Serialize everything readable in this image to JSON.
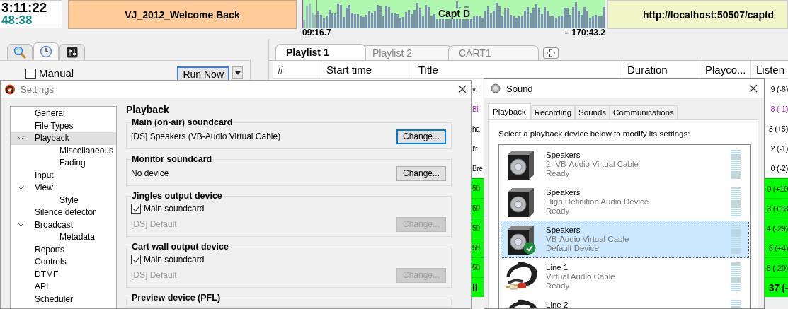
{
  "top_bar": {
    "clock": {
      "time": "3:11:22",
      "remaining": "48:38"
    },
    "now_playing": "VJ_2012_Welcome Back",
    "waveform": {
      "title": "Capt D",
      "elapsed": "09:16.7",
      "remaining": "– 170:43.2"
    },
    "stream_url": "http://localhost:50507/captd"
  },
  "left_panel": {
    "tabs": [
      {
        "kind": "search",
        "selected": false
      },
      {
        "kind": "clock",
        "selected": true
      },
      {
        "kind": "mixer",
        "selected": false
      }
    ],
    "manual": {
      "label": "Manual",
      "checked": false
    },
    "run_now": {
      "label": "Run Now",
      "focused": true
    }
  },
  "playlist": {
    "tabs": [
      {
        "label": "Playlist 1",
        "selected": true
      },
      {
        "label": "Playlist 2",
        "selected": false
      },
      {
        "label": "CART1",
        "selected": false
      }
    ],
    "columns": [
      "#",
      "Start time",
      "Title",
      "Duration",
      "Playco...",
      "Listen"
    ],
    "rows": [
      {
        "kind": "plain",
        "title": "yl",
        "listeners": "9 (-6)"
      },
      {
        "kind": "purple",
        "title": "Bi",
        "listeners": "8 (-1)"
      },
      {
        "kind": "plain",
        "title": "ha",
        "listeners": "3 (+5)"
      },
      {
        "kind": "plain",
        "title": "I'r",
        "listeners": "2 (-1)"
      },
      {
        "kind": "plain",
        "title": "Bre",
        "listeners": "0 (-2)"
      },
      {
        "kind": "green",
        "title": "50",
        "listeners": "0 (+10"
      },
      {
        "kind": "green",
        "title": "50",
        "listeners": "3 (+13"
      },
      {
        "kind": "green",
        "title": "50",
        "listeners": "4 (-29)"
      },
      {
        "kind": "green",
        "title": "50",
        "listeners": "8 (+4)"
      },
      {
        "kind": "green",
        "title": "50",
        "listeners": "8 (-20)"
      },
      {
        "kind": "green_bold",
        "title": "ll",
        "listeners": "37 (-"
      }
    ]
  },
  "settings_window": {
    "title": "Settings",
    "tree": [
      {
        "label": "General",
        "selected": false
      },
      {
        "label": "File Types",
        "selected": false
      },
      {
        "label": "Playback",
        "selected": true,
        "expanded": true,
        "children": [
          {
            "label": "Miscellaneous",
            "selected": false
          },
          {
            "label": "Fading",
            "selected": false
          }
        ]
      },
      {
        "label": "Input",
        "selected": false
      },
      {
        "label": "View",
        "selected": false,
        "expanded": true,
        "children": [
          {
            "label": "Style",
            "selected": false
          }
        ]
      },
      {
        "label": "Silence detector",
        "selected": false
      },
      {
        "label": "Broadcast",
        "selected": false,
        "expanded": true,
        "children": [
          {
            "label": "Metadata",
            "selected": false
          }
        ]
      },
      {
        "label": "Reports",
        "selected": false
      },
      {
        "label": "Controls",
        "selected": false
      },
      {
        "label": "DTMF",
        "selected": false
      },
      {
        "label": "API",
        "selected": false
      },
      {
        "label": "Scheduler",
        "selected": false
      }
    ],
    "heading": "Playback",
    "groups": [
      {
        "title": "Main (on-air) soundcard",
        "device": "[DS] Speakers (VB-Audio Virtual Cable)",
        "button": "Change...",
        "disabled": false,
        "focused": true
      },
      {
        "title": "Monitor soundcard",
        "device": "No device",
        "button": "Change...",
        "disabled": false,
        "focused": false
      },
      {
        "title": "Jingles output device",
        "option": {
          "label": "Main soundcard",
          "checked": true
        },
        "device": "[DS] Default",
        "button": "Change...",
        "disabled": true,
        "focused": false
      },
      {
        "title": "Cart wall output device",
        "option": {
          "label": "Main soundcard",
          "checked": true
        },
        "device": "[DS] Default",
        "button": "Change...",
        "disabled": true,
        "focused": false
      },
      {
        "title": "Preview device (PFL)"
      }
    ]
  },
  "sound_window": {
    "title": "Sound",
    "tabs": [
      {
        "label": "Playback",
        "selected": true
      },
      {
        "label": "Recording",
        "selected": false
      },
      {
        "label": "Sounds",
        "selected": false
      },
      {
        "label": "Communications",
        "selected": false
      }
    ],
    "instruction": "Select a playback device below to modify its settings:",
    "devices": [
      {
        "kind": "speaker",
        "name": "Speakers",
        "description": "2- VB-Audio Virtual Cable",
        "status": "Ready",
        "default": false,
        "selected": false
      },
      {
        "kind": "speaker",
        "name": "Speakers",
        "description": "High Definition Audio Device",
        "status": "Ready",
        "default": false,
        "selected": false
      },
      {
        "kind": "speaker",
        "name": "Speakers",
        "description": "VB-Audio Virtual Cable",
        "status": "Default Device",
        "default": true,
        "selected": true
      },
      {
        "kind": "cable",
        "name": "Line 1",
        "description": "Virtual Audio Cable",
        "status": "Ready",
        "default": false,
        "selected": false
      },
      {
        "kind": "cable",
        "name": "Line 2",
        "default": false,
        "selected": false
      }
    ]
  }
}
